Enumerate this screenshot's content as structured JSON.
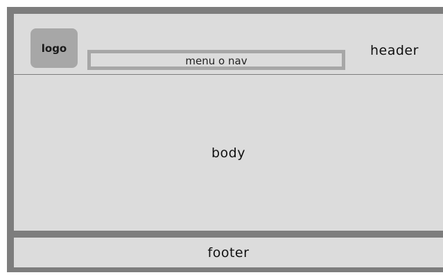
{
  "header": {
    "logo_label": "logo",
    "nav_label": "menu o nav",
    "label": "header"
  },
  "body": {
    "label": "body"
  },
  "footer": {
    "label": "footer"
  },
  "colors": {
    "frame": "#7d7d7d",
    "panel": "#dcdcdc",
    "accent_gray": "#a7a7a7"
  }
}
